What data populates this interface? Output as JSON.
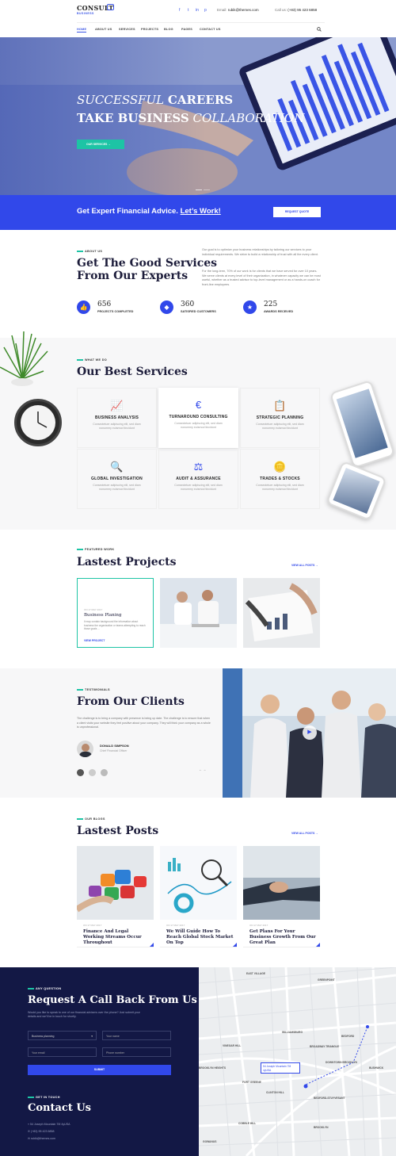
{
  "header": {
    "logo_main": "CONSULT",
    "logo_sub": "BUSINESS",
    "email_label": "Email:",
    "email_value": "rubik@themes.com",
    "call_label": "Call us:",
    "call_value": "(+83) 95 423 6858",
    "nav": [
      "HOME",
      "ABOUT US",
      "SERVICES",
      "PROJECTS",
      "BLOG",
      "PAGES",
      "CONTACT US"
    ]
  },
  "hero": {
    "line1_italic": "SUCCESSFUL",
    "line1_bold": "CAREERS",
    "line2_bold": "TAKE BUSINESS",
    "line2_italic": "COLLABORATION",
    "button": "OUR SERVICES"
  },
  "cta": {
    "text": "Get Expert Financial Advice.",
    "link": "Let’s Work!",
    "button": "REQUEST QUOTE"
  },
  "about": {
    "kicker": "ABOUT US",
    "title_line1": "Get The Good Services",
    "title_line2": "From Our Experts",
    "para1": "Our goal is to optimize your business relationships by tailoring our services to your individual requirements. We strive to build a relationship of trust with all the every client.",
    "para2": "For the long-term, 70% of our work is for clients that we have served for over 10 years. We serve clients at every level of their organization, in whatever capacity we can be most useful, whether as a trusted advisor to top-level management or as a hands-on coach for front-line employees.",
    "stats": [
      {
        "num": "656",
        "label": "PROJECTS COMPLETED"
      },
      {
        "num": "360",
        "label": "SATISFIED CUSTOMERS"
      },
      {
        "num": "225",
        "label": "AWARDS RECEIVED"
      }
    ]
  },
  "services": {
    "kicker": "WHAT WE DO",
    "title": "Our Best Services",
    "items": [
      {
        "title": "BUSINESS ANALYSIS",
        "desc": "Consectetuer adipiscing elit, sed diam nonummy euismod tincidunt"
      },
      {
        "title": "TURNAROUND CONSULTING",
        "desc": "Consectetuer adipiscing elit, sed diam nonummy euismod tincidunt"
      },
      {
        "title": "STRATEGIC PLANNING",
        "desc": "Consectetuer adipiscing elit, sed diam nonummy euismod tincidunt"
      },
      {
        "title": "GLOBAL INVESTIGATION",
        "desc": "Consectetuer adipiscing elit, sed diam nonummy euismod tincidunt"
      },
      {
        "title": "AUDIT & ASSURANCE",
        "desc": "Consectetuer adipiscing elit, sed diam nonummy euismod tincidunt"
      },
      {
        "title": "TRADES & STOCKS",
        "desc": "Consectetuer adipiscing elit, sed diam nonummy euismod tincidunt"
      }
    ]
  },
  "projects": {
    "kicker": "FEATURED WORK",
    "title": "Lastest Projects",
    "view_all": "VIEW ALL POSTS",
    "card_date": "ON 17 MAY 2017",
    "card_title": "Business Planing",
    "card_desc": "It may contain background the information about business the organization or teams attempting to reach those goals ...",
    "card_link": "VIEW PROJECT"
  },
  "testimonials": {
    "kicker": "TESTIMONIALS",
    "title": "From Our Clients",
    "quote": "The challenge is to bring a company with presence is being up date. The challenge is to ensure that when a client visits your website they feel positive about your company. They will think your company as a whole is unprofessional.",
    "name": "DONALD SIMPSON",
    "role": "Chief Financial Officer",
    "nav": "← →"
  },
  "blog": {
    "kicker": "OUR BLOGS",
    "title": "Lastest Posts",
    "view_all": "VIEW ALL POSTS",
    "posts": [
      {
        "date": "ON 17 MAY 2017",
        "title": "Finance And Legal Working Streams Occur Throughout"
      },
      {
        "date": "ON 17 MAY 2017",
        "title": "We Will Guide How To Reach Global Stock Market On Top"
      },
      {
        "date": "ON 17 MAY 2017",
        "title": "Get Plans For Your Business Growth From Our Great Plan"
      }
    ]
  },
  "callback": {
    "kicker": "ANY QUESTION",
    "title": "Request A Call Back From Us",
    "desc": "Would you like to speak to one of our financial advisers over the phone? Just submit your details and we’ll be in touch for shortly.",
    "select_value": "Business planning",
    "name_placeholder": "Your name",
    "email_placeholder": "Your email",
    "phone_placeholder": "Phone number",
    "submit": "SUBMIT"
  },
  "contact": {
    "kicker": "GET IN TOUCH",
    "title": "Contact Us",
    "address": "54 Joseph Mountain 7M 4yUSA",
    "phone": "(+83) 95 423 6858",
    "email": "rubik@themes.com"
  },
  "map": {
    "popup": "54 Joseph Mountain 7M 4yUSA",
    "labels": [
      "EAST VILLAGE",
      "GREENPOINT",
      "WILLIAMSBURG",
      "BEDFORD",
      "BROADWAY TRIANGLE",
      "VINEGAR HILL",
      "BROOKLYN HEIGHTS",
      "DOWNTOWN BROOKLYN",
      "FORT GREENE",
      "BUSHWICK",
      "CLINTON HILL",
      "BEDFORD-STUYVESANT",
      "BROOKLYN",
      "GOWANUS",
      "COBBLE HILL"
    ]
  },
  "colors": {
    "primary": "#3148ea",
    "accent": "#1dc4a5",
    "dark": "#131845"
  }
}
